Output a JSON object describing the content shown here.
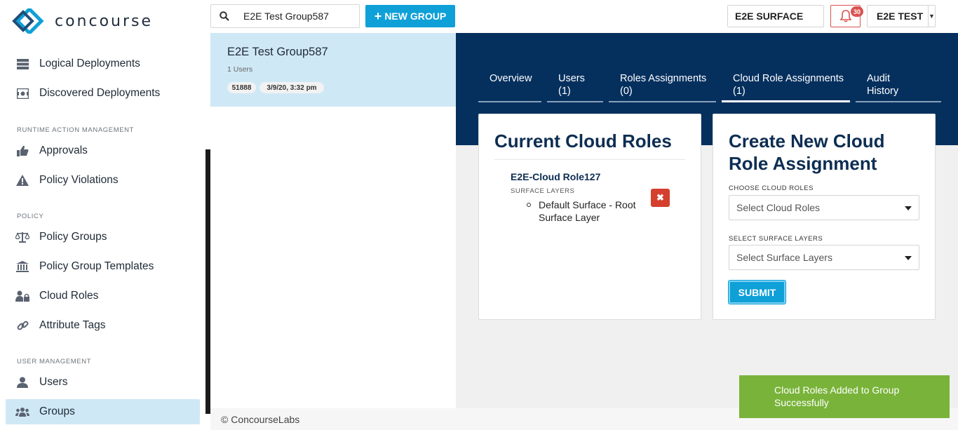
{
  "brand": {
    "name": "concourse",
    "accent": "#0fa0d8",
    "nav_dark": "#05305e",
    "success": "#79b33a",
    "danger": "#d43f2e"
  },
  "sidebar": {
    "items_top": [
      {
        "label": "Logical Deployments",
        "icon": "server-stack-icon"
      },
      {
        "label": "Discovered Deployments",
        "icon": "discover-icon"
      }
    ],
    "sections": [
      {
        "title": "RUNTIME ACTION MANAGEMENT",
        "items": [
          {
            "label": "Approvals",
            "icon": "thumbs-up-icon"
          },
          {
            "label": "Policy Violations",
            "icon": "warning-icon"
          }
        ]
      },
      {
        "title": "POLICY",
        "items": [
          {
            "label": "Policy Groups",
            "icon": "scale-icon"
          },
          {
            "label": "Policy Group Templates",
            "icon": "bank-icon"
          },
          {
            "label": "Cloud Roles",
            "icon": "user-lock-icon"
          },
          {
            "label": "Attribute Tags",
            "icon": "link-icon"
          }
        ]
      },
      {
        "title": "USER MANAGEMENT",
        "items": [
          {
            "label": "Users",
            "icon": "user-icon"
          },
          {
            "label": "Groups",
            "icon": "users-icon",
            "active": true
          }
        ]
      }
    ]
  },
  "topbar": {
    "search_value": "E2E Test Group587",
    "new_group_label": "NEW GROUP",
    "surface_label": "E2E SURFACE",
    "notification_count": "30",
    "user_label": "E2E TEST"
  },
  "group_list": [
    {
      "name": "E2E Test Group587",
      "users": "1 Users",
      "id": "51888",
      "date": "3/9/20, 3:32 pm"
    }
  ],
  "tabs": [
    {
      "line1": "Overview",
      "line2": ""
    },
    {
      "line1": "Users",
      "line2": "(1)"
    },
    {
      "line1": "Roles Assignments",
      "line2": "(0)"
    },
    {
      "line1": "Cloud Role Assignments",
      "line2": "(1)",
      "active": true
    },
    {
      "line1": "Audit",
      "line2": "History"
    }
  ],
  "current_roles": {
    "title": "Current Cloud Roles",
    "roles": [
      {
        "name": "E2E-Cloud Role127",
        "layers_label": "SURFACE LAYERS",
        "layers": [
          "Default Surface - Root Surface Layer"
        ]
      }
    ]
  },
  "create_form": {
    "title_line1": "Create New Cloud",
    "title_line2": "Role Assignment",
    "roles_label": "CHOOSE CLOUD ROLES",
    "roles_placeholder": "Select Cloud Roles",
    "layers_label": "SELECT SURFACE LAYERS",
    "layers_placeholder": "Select Surface Layers",
    "submit_label": "SUBMIT"
  },
  "footer": {
    "text": "© ConcourseLabs"
  },
  "toast": {
    "line1": "Cloud Roles Added to Group",
    "line2": "Successfully"
  }
}
